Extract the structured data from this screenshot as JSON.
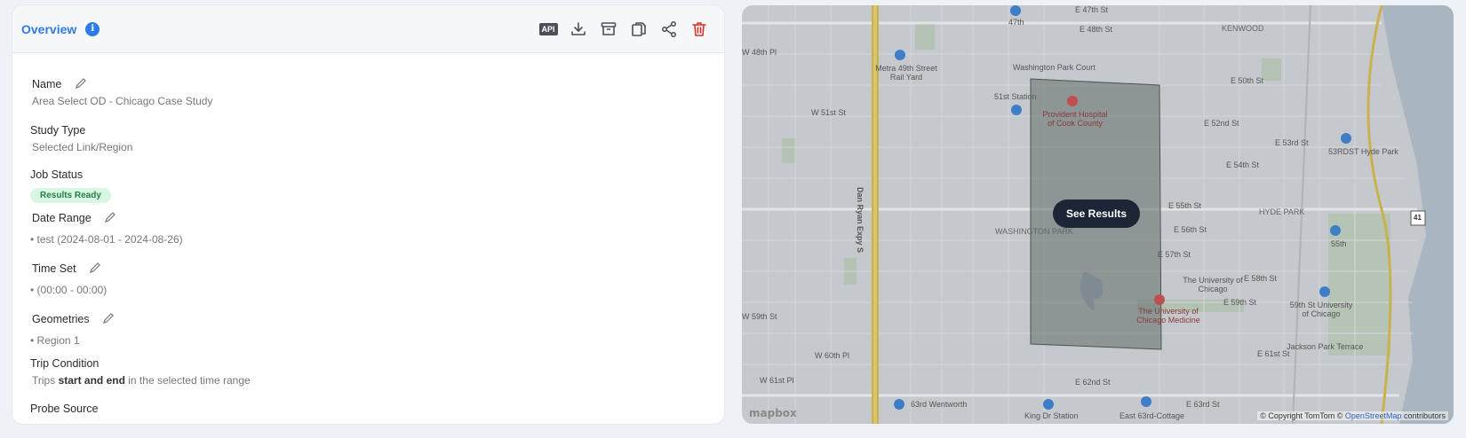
{
  "overview": {
    "title": "Overview",
    "info_icon": "info-icon",
    "toolbar": {
      "api_label": "API",
      "icons": [
        "api-icon",
        "download-icon",
        "archive-icon",
        "copy-icon",
        "share-icon",
        "trash-icon"
      ]
    }
  },
  "fields": {
    "name": {
      "label": "Name",
      "value": "Area Select OD - Chicago Case Study"
    },
    "study_type": {
      "label": "Study Type",
      "value": "Selected Link/Region"
    },
    "job_status": {
      "label": "Job Status",
      "value": "Results Ready"
    },
    "date_range": {
      "label": "Date Range",
      "value": "• test (2024-08-01 - 2024-08-26)"
    },
    "time_set": {
      "label": "Time Set",
      "value": "• (00:00 - 00:00)"
    },
    "geometries": {
      "label": "Geometries",
      "value": "• Region 1"
    },
    "trip_condition": {
      "label": "Trip Condition",
      "value_prefix": "Trips ",
      "value_bold": "start and end",
      "value_suffix": " in the selected time range"
    },
    "probe_source": {
      "label": "Probe Source"
    }
  },
  "map": {
    "button": "See Results",
    "attribution_prefix": "© Copyright TomTom © ",
    "attribution_osm": "OpenStreetMap",
    "attribution_suffix": " contributors",
    "logo": "mapbox",
    "labels": {
      "w48": "W 48th Pl",
      "w51": "W 51st St",
      "w59": "W 59th St",
      "w60": "W 60th Pl",
      "w61": "W 61st Pl",
      "e47": "E 47th St",
      "e48": "E 48th St",
      "e50": "E 50th St",
      "e52": "E 52nd St",
      "e53": "E 53rd St",
      "e54": "E 54th St",
      "e55": "E 55th St",
      "e56": "E 56th St",
      "e57": "E 57th St",
      "e58": "E 58th St",
      "e59": "E 59th St",
      "e61": "E 61st St",
      "e62": "E 62nd St",
      "e63": "E 63rd St",
      "kenwood": "KENWOOD",
      "hydepark": "HYDE PARK",
      "washington": "WASHINGTON PARK",
      "wpcourt": "Washington Park Court",
      "dryan": "Dan Ryan Expy S",
      "metra": "Metra 49th Street Rail Yard",
      "uchicago": "The University of Chicago",
      "ucmed": "The University of Chicago Medicine",
      "provident": "Provident Hospital of Cook County",
      "jackson": "Jackson Park Terrace",
      "hp53": "53RDST Hyde Park",
      "s59univ": "59th St University of Chicago",
      "wentworth": "63rd Wentworth",
      "kingdr": "King Dr Station",
      "e63station": "East 63rd-Cottage",
      "s51": "51st Station",
      "s55": "55th",
      "s47": "47th",
      "rt41": "41"
    }
  }
}
